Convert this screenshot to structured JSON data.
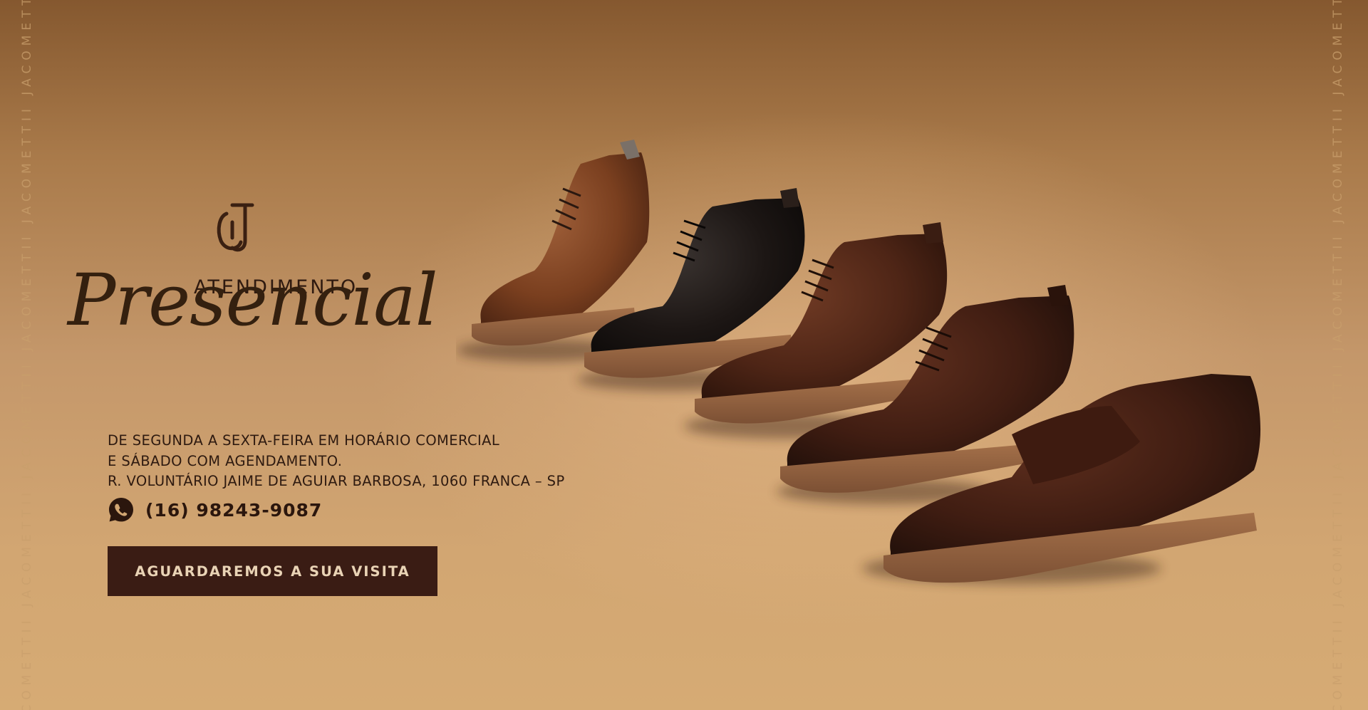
{
  "banner": {
    "watermark_text": "JACOMETTII  JACOMETTII  JACOMETTII  JACOMETTII  JACOMETTII  JACOMETTII",
    "heading_small": "ATENDIMENTO",
    "heading_script": "Presencial",
    "info_lines": [
      "DE SEGUNDA A SEXTA-FEIRA EM HORÁRIO COMERCIAL",
      "E SÁBADO COM AGENDAMENTO.",
      "R. VOLUNTÁRIO JAIME DE AGUIAR BARBOSA, 1060 FRANCA – SP"
    ],
    "phone": "(16) 98243-9087",
    "cta_label": "AGUARDAREMOS A SUA VISITA",
    "icons": {
      "logo": "jacometti-monogram-logo",
      "phone": "whatsapp-icon"
    },
    "colors": {
      "text_dark": "#2e1a10",
      "button_bg": "#3a1c14",
      "button_text": "#e9d3b5",
      "watermark": "#c99f6c"
    }
  }
}
